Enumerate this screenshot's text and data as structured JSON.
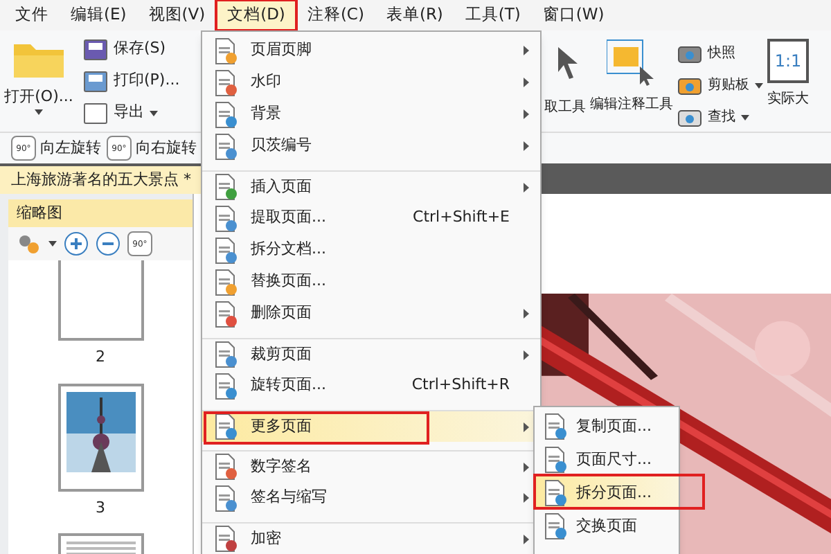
{
  "menu_bar": [
    {
      "label": "文件",
      "selected": false,
      "annotated": false
    },
    {
      "label": "编辑(E)",
      "selected": false,
      "annotated": false
    },
    {
      "label": "视图(V)",
      "selected": false,
      "annotated": false
    },
    {
      "label": "文档(D)",
      "selected": true,
      "annotated": true
    },
    {
      "label": "注释(C)",
      "selected": false,
      "annotated": false
    },
    {
      "label": "表单(R)",
      "selected": false,
      "annotated": false
    },
    {
      "label": "工具(T)",
      "selected": false,
      "annotated": false
    },
    {
      "label": "窗口(W)",
      "selected": false,
      "annotated": false
    }
  ],
  "ribbon": {
    "open": "打开(O)...",
    "file_buttons": [
      {
        "label": "保存(S)",
        "dropdown": false
      },
      {
        "label": "打印(P)...",
        "dropdown": false
      },
      {
        "label": "导出",
        "dropdown": true
      }
    ],
    "tools": [
      "取工具",
      "编辑注释工具"
    ],
    "small_buttons": [
      {
        "label": "快照",
        "dropdown": false
      },
      {
        "label": "剪贴板",
        "dropdown": true
      },
      {
        "label": "查找",
        "dropdown": true
      }
    ],
    "actual_size": {
      "icon_text": "1:1",
      "label": "实际大"
    },
    "rotate": [
      {
        "icon_text": "90°",
        "label": "向左旋转"
      },
      {
        "icon_text": "90°",
        "label": "向右旋转"
      }
    ]
  },
  "document_tab": {
    "title": "上海旅游著名的五大景点 *"
  },
  "thumbnail_panel": {
    "title": "缩略图",
    "rotate_icon_text": "90°",
    "pages": [
      {
        "kind": "blank",
        "label": "2"
      },
      {
        "label": "3"
      },
      {
        "kind": "text"
      }
    ]
  },
  "document_menu": {
    "items": [
      {
        "label": "页眉页脚",
        "submenu": true,
        "separator_before": false,
        "selected": false,
        "annotated": false
      },
      {
        "label": "水印",
        "submenu": true,
        "separator_before": false,
        "selected": false,
        "annotated": false
      },
      {
        "label": "背景",
        "submenu": true,
        "separator_before": false,
        "selected": false,
        "annotated": false
      },
      {
        "label": "贝茨编号",
        "submenu": true,
        "separator_before": false,
        "selected": false,
        "annotated": false
      },
      {
        "label": "插入页面",
        "submenu": true,
        "separator_before": true,
        "selected": false,
        "annotated": false
      },
      {
        "label": "提取页面...",
        "shortcut": "Ctrl+Shift+E",
        "submenu": false,
        "separator_before": false,
        "selected": false,
        "annotated": false
      },
      {
        "label": "拆分文档...",
        "submenu": false,
        "separator_before": false,
        "selected": false,
        "annotated": false
      },
      {
        "label": "替换页面...",
        "submenu": false,
        "separator_before": false,
        "selected": false,
        "annotated": false
      },
      {
        "label": "删除页面",
        "submenu": true,
        "separator_before": false,
        "selected": false,
        "annotated": false
      },
      {
        "label": "裁剪页面",
        "submenu": true,
        "separator_before": true,
        "selected": false,
        "annotated": false
      },
      {
        "label": "旋转页面...",
        "shortcut": "Ctrl+Shift+R",
        "submenu": false,
        "separator_before": false,
        "selected": false,
        "annotated": false
      },
      {
        "label": "更多页面",
        "submenu": true,
        "separator_before": true,
        "selected": true,
        "annotated": true
      },
      {
        "label": "数字签名",
        "submenu": true,
        "separator_before": true,
        "selected": false,
        "annotated": false
      },
      {
        "label": "签名与缩写",
        "submenu": true,
        "separator_before": false,
        "selected": false,
        "annotated": false
      },
      {
        "label": "加密",
        "submenu": true,
        "separator_before": true,
        "selected": false,
        "annotated": false
      }
    ]
  },
  "submenu": {
    "items": [
      {
        "label": "复制页面...",
        "selected": false,
        "annotated": false
      },
      {
        "label": "页面尺寸...",
        "selected": false,
        "annotated": false
      },
      {
        "label": "拆分页面...",
        "selected": true,
        "annotated": true
      },
      {
        "label": "交换页面",
        "selected": false,
        "annotated": false
      }
    ]
  }
}
